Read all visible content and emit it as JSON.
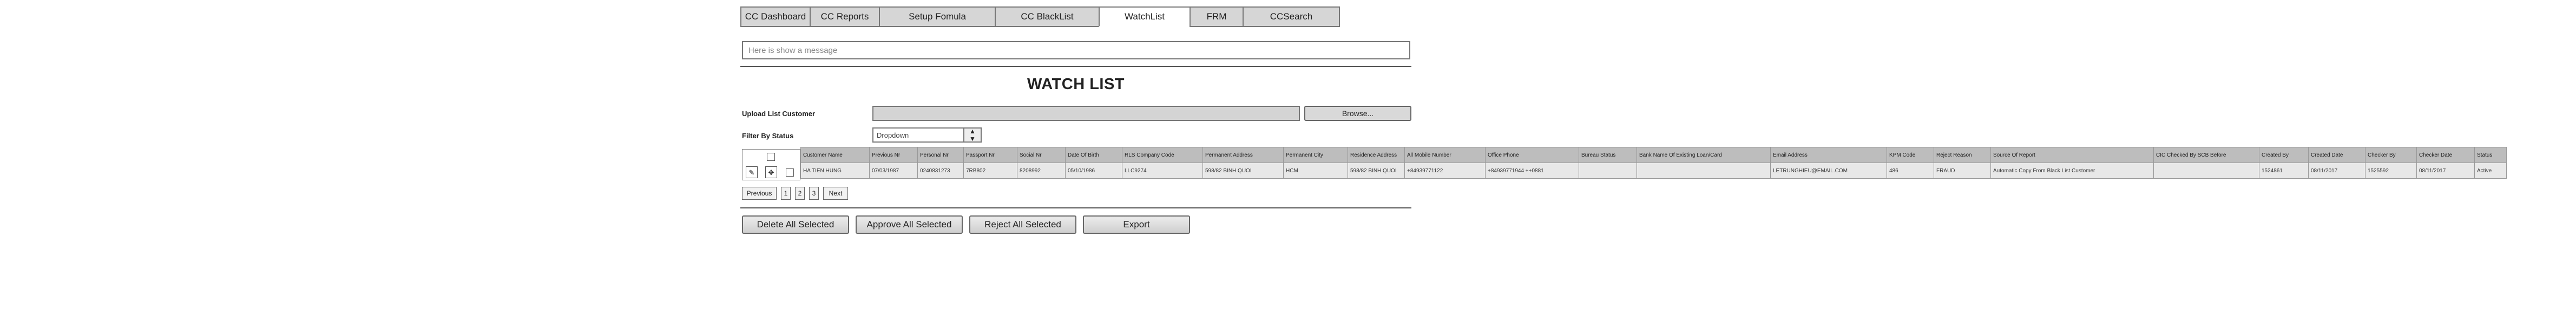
{
  "tabs": [
    {
      "label": "CC Dashboard"
    },
    {
      "label": "CC Reports"
    },
    {
      "label": "Setup Fomula"
    },
    {
      "label": "CC BlackList"
    },
    {
      "label": "WatchList"
    },
    {
      "label": "FRM"
    },
    {
      "label": "CCSearch"
    }
  ],
  "active_tab": "WatchList",
  "message": {
    "placeholder": "Here is show a message"
  },
  "page_title": "WATCH LIST",
  "upload": {
    "label": "Upload List Customer",
    "browse_label": "Browse..."
  },
  "filter": {
    "label": "Filter By Status",
    "selected": "Dropdown"
  },
  "table": {
    "columns": [
      "Customer Name",
      "Previous Nr",
      "Personal Nr",
      "Passport Nr",
      "Social Nr",
      "Date Of Birth",
      "RLS Company Code",
      "Permanent Address",
      "Permanent City",
      "Residence Address",
      "All Mobile Number",
      "Office Phone",
      "Bureau Status",
      "Bank Name Of Existing Loan/Card",
      "Email Address",
      "KPM Code",
      "Reject Reason",
      "Source Of Report",
      "CIC Checked By SCB Before",
      "Created By",
      "Created Date",
      "Checker By",
      "Checker Date",
      "Status"
    ],
    "rows": [
      [
        "HA TIEN HUNG",
        "07/03/1987",
        "0240831273",
        "7RB802",
        "8208992",
        "05/10/1986",
        "LLC9274",
        "598/82 BINH QUOI",
        "HCM",
        "598/82 BINH QUOI",
        "+84939771122",
        "+84939771944 ++0881",
        "",
        "",
        "LETRUNGHIEU@EMAIL.COM",
        "486",
        "FRAUD",
        "Automatic Copy From Black List Customer",
        "",
        "1524861",
        "08/11/2017",
        "1525592",
        "08/11/2017",
        "Active"
      ]
    ]
  },
  "pagination": {
    "previous": "Previous",
    "pages": [
      "1",
      "2",
      "3"
    ],
    "next": "Next"
  },
  "actions": {
    "delete": "Delete All Selected",
    "approve": "Approve All Selected",
    "reject": "Reject All Selected",
    "export": "Export"
  }
}
